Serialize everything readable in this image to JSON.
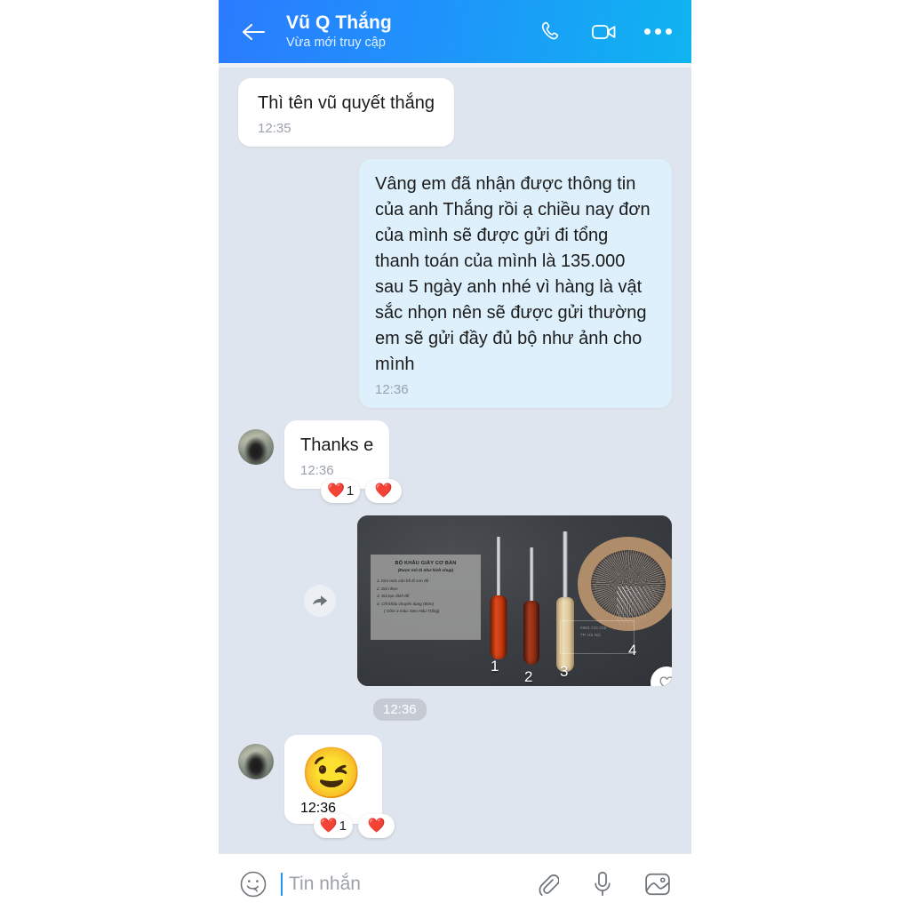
{
  "header": {
    "back_icon": "back-arrow-icon",
    "name": "Vũ Q Thắng",
    "status": "Vừa mới truy cập",
    "call_icon": "phone-icon",
    "video_icon": "video-camera-icon",
    "more_icon": "more-options-icon",
    "gradient_start": "#2b7bff",
    "gradient_end": "#0fb4f0"
  },
  "chat": {
    "background": "#dfe5ee",
    "messages": [
      {
        "id": "msg-1",
        "direction": "incoming",
        "type": "text",
        "text": "Thì tên vũ quyết thắng",
        "time": "12:35",
        "bubble_color": "#ffffff"
      },
      {
        "id": "msg-2",
        "direction": "outgoing",
        "type": "text",
        "text": "Vâng em đã nhận được thông tin của anh Thắng rồi ạ chiều nay đơn của mình sẽ được gửi đi tổng thanh toán của mình là 135.000 sau 5 ngày anh nhé vì hàng là vật sắc nhọn nên sẽ được gửi thường em sẽ gửi đầy đủ bộ như ảnh cho mình",
        "time": "12:36",
        "bubble_color": "#ddf0fb"
      },
      {
        "id": "msg-3",
        "direction": "incoming",
        "type": "text",
        "text": "Thanks e",
        "time": "12:36",
        "bubble_color": "#ffffff",
        "reactions": [
          {
            "emoji": "❤️",
            "count": "1"
          },
          {
            "emoji": "❤️",
            "count": ""
          }
        ]
      },
      {
        "id": "msg-4",
        "direction": "outgoing",
        "type": "image",
        "time": "12:36",
        "forward_icon": "forward-arrow-icon",
        "like_icon": "heart-outline-icon"
      },
      {
        "id": "msg-5",
        "direction": "incoming",
        "type": "emoji",
        "emoji": "😉",
        "time": "12:36",
        "reactions": [
          {
            "emoji": "❤️",
            "count": "1"
          },
          {
            "emoji": "❤️",
            "count": ""
          }
        ]
      }
    ]
  },
  "photo": {
    "alt_name": "leather-sewing-tool-kit-photo",
    "caption_title": "BỘ KHÂU GIÀY CƠ BẢN",
    "caption_subtitle": "(Được mô tả như hình chụp)",
    "caption_items": [
      "1. Kim móc cán hồ lô sơn đỏ",
      "2. Dùi nhọn",
      "3. Sủi tạo rãnh đế",
      "4. Chỉ khâu chuyên dụng (80m)",
      "( Gồm 3 màu: Đen-Nâu-Trắng)"
    ],
    "labels": [
      "1",
      "2",
      "3",
      "4"
    ],
    "watermark_lines": [
      "0963.743.315",
      "TP. Hà Nội"
    ]
  },
  "input": {
    "emoji_icon": "smiley-face-icon",
    "placeholder": "Tin nhắn",
    "value": "",
    "attach_icon": "paperclip-icon",
    "mic_icon": "microphone-icon",
    "gallery_icon": "image-gallery-icon",
    "caret_color": "#2196f3"
  }
}
